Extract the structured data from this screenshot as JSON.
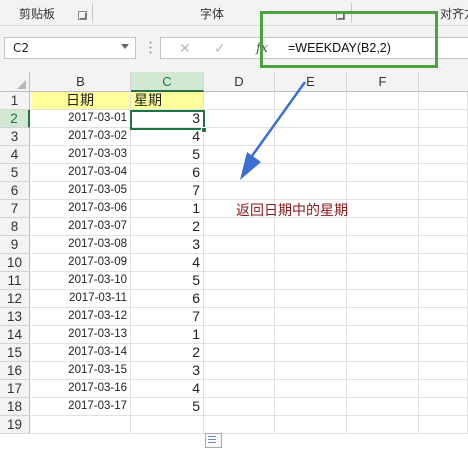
{
  "ribbon": {
    "groups": [
      "剪贴板",
      "字体",
      "对齐方"
    ]
  },
  "formula_bar": {
    "name_box": "C2",
    "cancel_icon": "✕",
    "enter_icon": "✓",
    "fx_label": "fx",
    "formula": "=WEEKDAY(B2,2)"
  },
  "grid": {
    "columns": [
      "B",
      "C",
      "D",
      "E",
      "F"
    ],
    "selected_cell": "C2",
    "header_row": {
      "row": "1",
      "B": "日期",
      "C": "星期"
    },
    "rows": [
      {
        "row": "2",
        "date": "2017-03-01",
        "weekday": "3"
      },
      {
        "row": "3",
        "date": "2017-03-02",
        "weekday": "4"
      },
      {
        "row": "4",
        "date": "2017-03-03",
        "weekday": "5"
      },
      {
        "row": "5",
        "date": "2017-03-04",
        "weekday": "6"
      },
      {
        "row": "6",
        "date": "2017-03-05",
        "weekday": "7"
      },
      {
        "row": "7",
        "date": "2017-03-06",
        "weekday": "1"
      },
      {
        "row": "8",
        "date": "2017-03-07",
        "weekday": "2"
      },
      {
        "row": "9",
        "date": "2017-03-08",
        "weekday": "3"
      },
      {
        "row": "10",
        "date": "2017-03-09",
        "weekday": "4"
      },
      {
        "row": "11",
        "date": "2017-03-10",
        "weekday": "5"
      },
      {
        "row": "12",
        "date": "2017-03-11",
        "weekday": "6"
      },
      {
        "row": "13",
        "date": "2017-03-12",
        "weekday": "7"
      },
      {
        "row": "14",
        "date": "2017-03-13",
        "weekday": "1"
      },
      {
        "row": "15",
        "date": "2017-03-14",
        "weekday": "2"
      },
      {
        "row": "16",
        "date": "2017-03-15",
        "weekday": "3"
      },
      {
        "row": "17",
        "date": "2017-03-16",
        "weekday": "4"
      },
      {
        "row": "18",
        "date": "2017-03-17",
        "weekday": "5"
      },
      {
        "row": "19",
        "date": "",
        "weekday": ""
      }
    ]
  },
  "annotation": {
    "text": "返回日期中的星期",
    "text_color": "#8b1a1a",
    "arrow_color": "#3b6fd4",
    "highlight_box_color": "#4aa33c"
  },
  "colors": {
    "selection_accent": "#217346",
    "header_fill": "#ffff99"
  }
}
